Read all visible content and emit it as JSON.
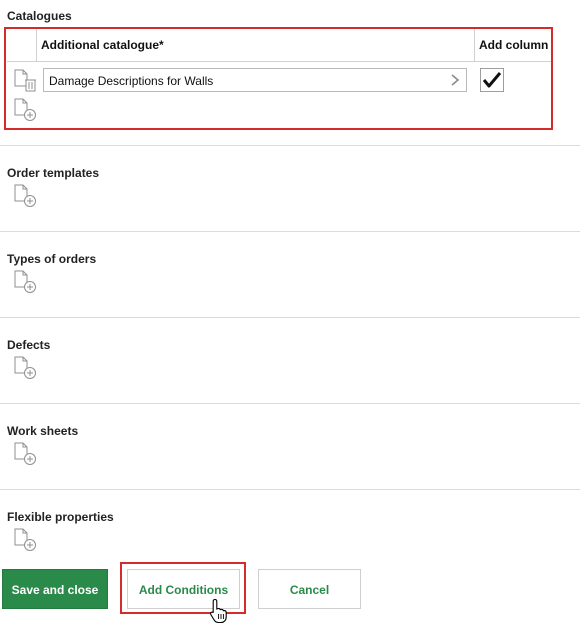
{
  "catalogues": {
    "title": "Catalogues",
    "column_catalogue": "Additional catalogue*",
    "column_add": "Add column",
    "rows": [
      {
        "value": "Damage Descriptions for Walls",
        "add_column_checked": true
      }
    ]
  },
  "sections": [
    {
      "title": "Order templates"
    },
    {
      "title": "Types of orders"
    },
    {
      "title": "Defects"
    },
    {
      "title": "Work sheets"
    },
    {
      "title": "Flexible properties"
    }
  ],
  "buttons": {
    "save_close": "Save and close",
    "add_conditions": "Add Conditions",
    "cancel": "Cancel"
  },
  "icons": {
    "add": "document-add-icon",
    "delete": "trash-icon",
    "chevron": "chevron-right-icon",
    "check": "checkmark-icon"
  },
  "colors": {
    "accent_green": "#2a8a4a",
    "highlight_red": "#d62b2b"
  }
}
